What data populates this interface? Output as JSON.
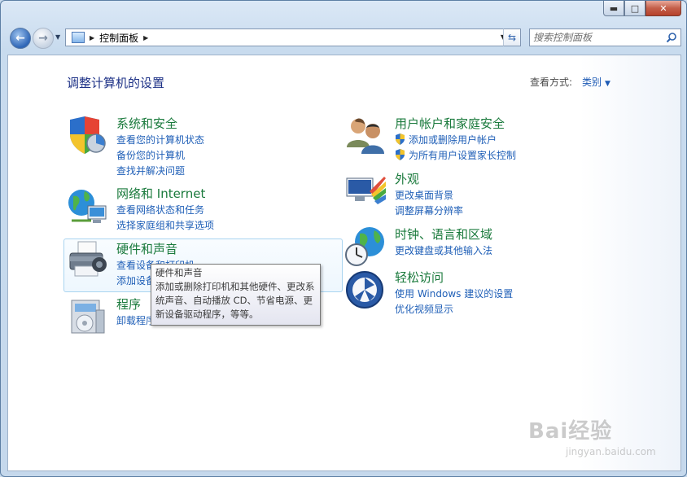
{
  "window": {
    "controls": {
      "minimize": "▬",
      "maximize": "□",
      "close": "✕"
    }
  },
  "address_bar": {
    "crumb": "控制面板",
    "search_placeholder": "搜索控制面板"
  },
  "main": {
    "heading": "调整计算机的设置",
    "view_by_label": "查看方式:",
    "view_by_value": "类别"
  },
  "categories": [
    {
      "title": "系统和安全",
      "links": [
        "查看您的计算机状态",
        "备份您的计算机",
        "查找并解决问题"
      ],
      "icon": "shield-security-icon"
    },
    {
      "title": "网络和 Internet",
      "links": [
        "查看网络状态和任务",
        "选择家庭组和共享选项"
      ],
      "icon": "network-globe-icon"
    },
    {
      "title": "硬件和声音",
      "links": [
        "查看设备和打印机",
        "添加设备"
      ],
      "icon": "printer-icon"
    },
    {
      "title": "程序",
      "links": [
        "卸载程序"
      ],
      "icon": "programs-icon"
    },
    {
      "title": "用户帐户和家庭安全",
      "links": [
        "添加或删除用户帐户",
        "为所有用户设置家长控制"
      ],
      "icon": "users-icon"
    },
    {
      "title": "外观",
      "links": [
        "更改桌面背景",
        "调整屏幕分辨率"
      ],
      "icon": "appearance-icon"
    },
    {
      "title": "时钟、语言和区域",
      "links": [
        "更改键盘或其他输入法"
      ],
      "icon": "clock-globe-icon"
    },
    {
      "title": "轻松访问",
      "links": [
        "使用 Windows 建议的设置",
        "优化视频显示"
      ],
      "icon": "ease-of-access-icon"
    }
  ],
  "tooltip": {
    "title": "硬件和声音",
    "body": "添加或删除打印机和其他硬件、更改系统声音、自动播放 CD、节省电源、更新设备驱动程序，等等。"
  },
  "watermark": {
    "brand": "Bai经验",
    "url": "jingyan.baidu.com"
  },
  "colors": {
    "link": "#1f5fb7",
    "category_title": "#1a7a3c",
    "heading": "#1e3287"
  }
}
